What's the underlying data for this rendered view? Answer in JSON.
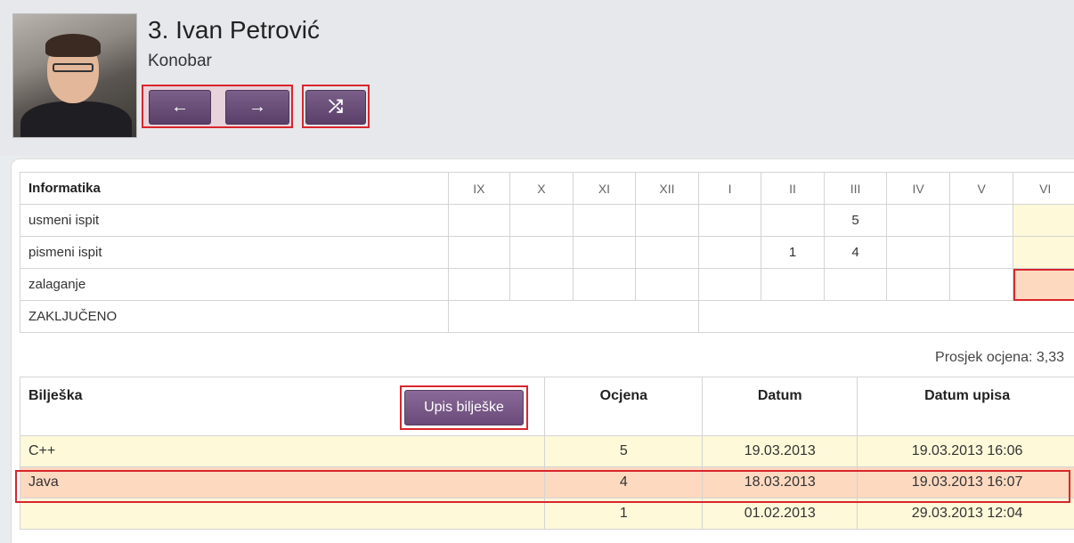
{
  "student": {
    "name": "3. Ivan Petrović",
    "role": "Konobar"
  },
  "nav": {
    "prev_icon": "arrow-left-icon",
    "prev_glyph": "←",
    "next_icon": "arrow-right-icon",
    "next_glyph": "→",
    "shuffle_icon": "shuffle-icon",
    "shuffle_glyph": "⤮"
  },
  "grades": {
    "subject": "Informatika",
    "months": [
      "IX",
      "X",
      "XI",
      "XII",
      "I",
      "II",
      "III",
      "IV",
      "V",
      "VI"
    ],
    "rows": [
      {
        "label": "usmeni ispit",
        "values": [
          "",
          "",
          "",
          "",
          "",
          "",
          "5",
          "",
          "",
          ""
        ]
      },
      {
        "label": "pismeni ispit",
        "values": [
          "",
          "",
          "",
          "",
          "",
          "1",
          "4",
          "",
          "",
          ""
        ]
      },
      {
        "label": "zalaganje",
        "values": [
          "",
          "",
          "",
          "",
          "",
          "",
          "",
          "",
          "",
          ""
        ]
      }
    ],
    "final_label": "ZAKLJUČENO"
  },
  "average": "Prosjek ocjena: 3,33",
  "notes": {
    "headers": [
      "Bilješka",
      "Ocjena",
      "Datum",
      "Datum upisa"
    ],
    "add_button": "Upis bilješke",
    "rows": [
      {
        "note": "C++",
        "grade": "5",
        "date": "19.03.2013",
        "entry_date": "19.03.2013 16:06"
      },
      {
        "note": "Java",
        "grade": "4",
        "date": "18.03.2013",
        "entry_date": "19.03.2013 16:07"
      },
      {
        "note": "",
        "grade": "1",
        "date": "01.02.2013",
        "entry_date": "29.03.2013 12:04"
      }
    ]
  },
  "colors": {
    "button": "#6a4a79",
    "highlight_yellow": "#fdf9d9",
    "highlight_orange": "#fdd9c0",
    "marker_red": "#d9262c"
  }
}
